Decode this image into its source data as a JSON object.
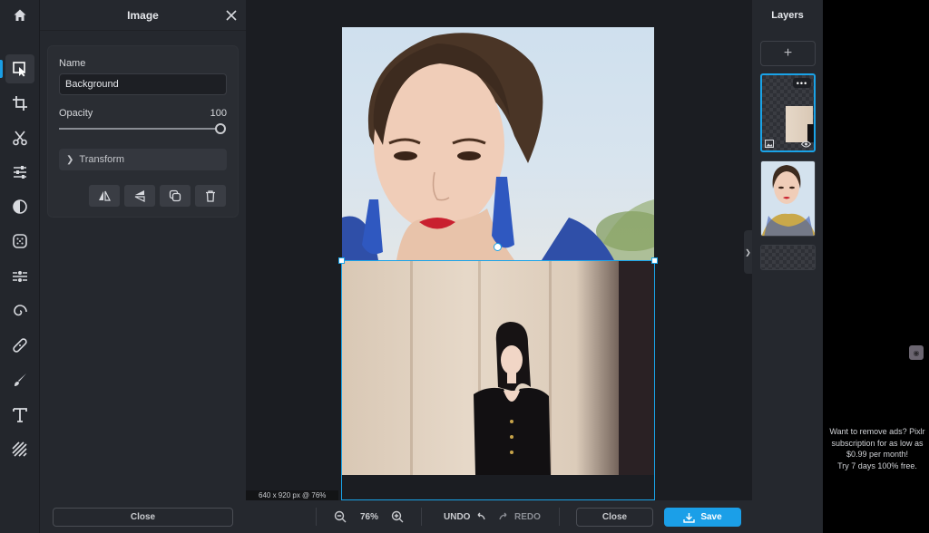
{
  "panel": {
    "title": "Image",
    "name_label": "Name",
    "name_value": "Background",
    "opacity_label": "Opacity",
    "opacity_value": "100",
    "opacity_fraction": 1.0,
    "transform_label": "Transform",
    "close_label": "Close"
  },
  "toolbar": {
    "tools": [
      "home-icon",
      "arrange-icon",
      "crop-icon",
      "cutout-icon",
      "adjust-icon",
      "filter-icon",
      "effect-icon",
      "liquify-icon",
      "retouch-icon",
      "heal-icon",
      "draw-icon",
      "text-icon",
      "elements-icon"
    ]
  },
  "canvas": {
    "dims_label": "640 x 920 px @ 76%"
  },
  "bottombar": {
    "zoom": "76%",
    "undo": "UNDO",
    "redo": "REDO",
    "close": "Close",
    "save": "Save"
  },
  "layers": {
    "title": "Layers",
    "add": "+"
  },
  "ad": {
    "line1": "Want to remove ads? Pixlr subscription for as low as $0.99 per month!",
    "line2": "Try 7 days 100% free."
  },
  "colors": {
    "accent": "#1b9fe8",
    "panel_bg": "#25282e",
    "canvas_bg": "#1b1d22"
  }
}
